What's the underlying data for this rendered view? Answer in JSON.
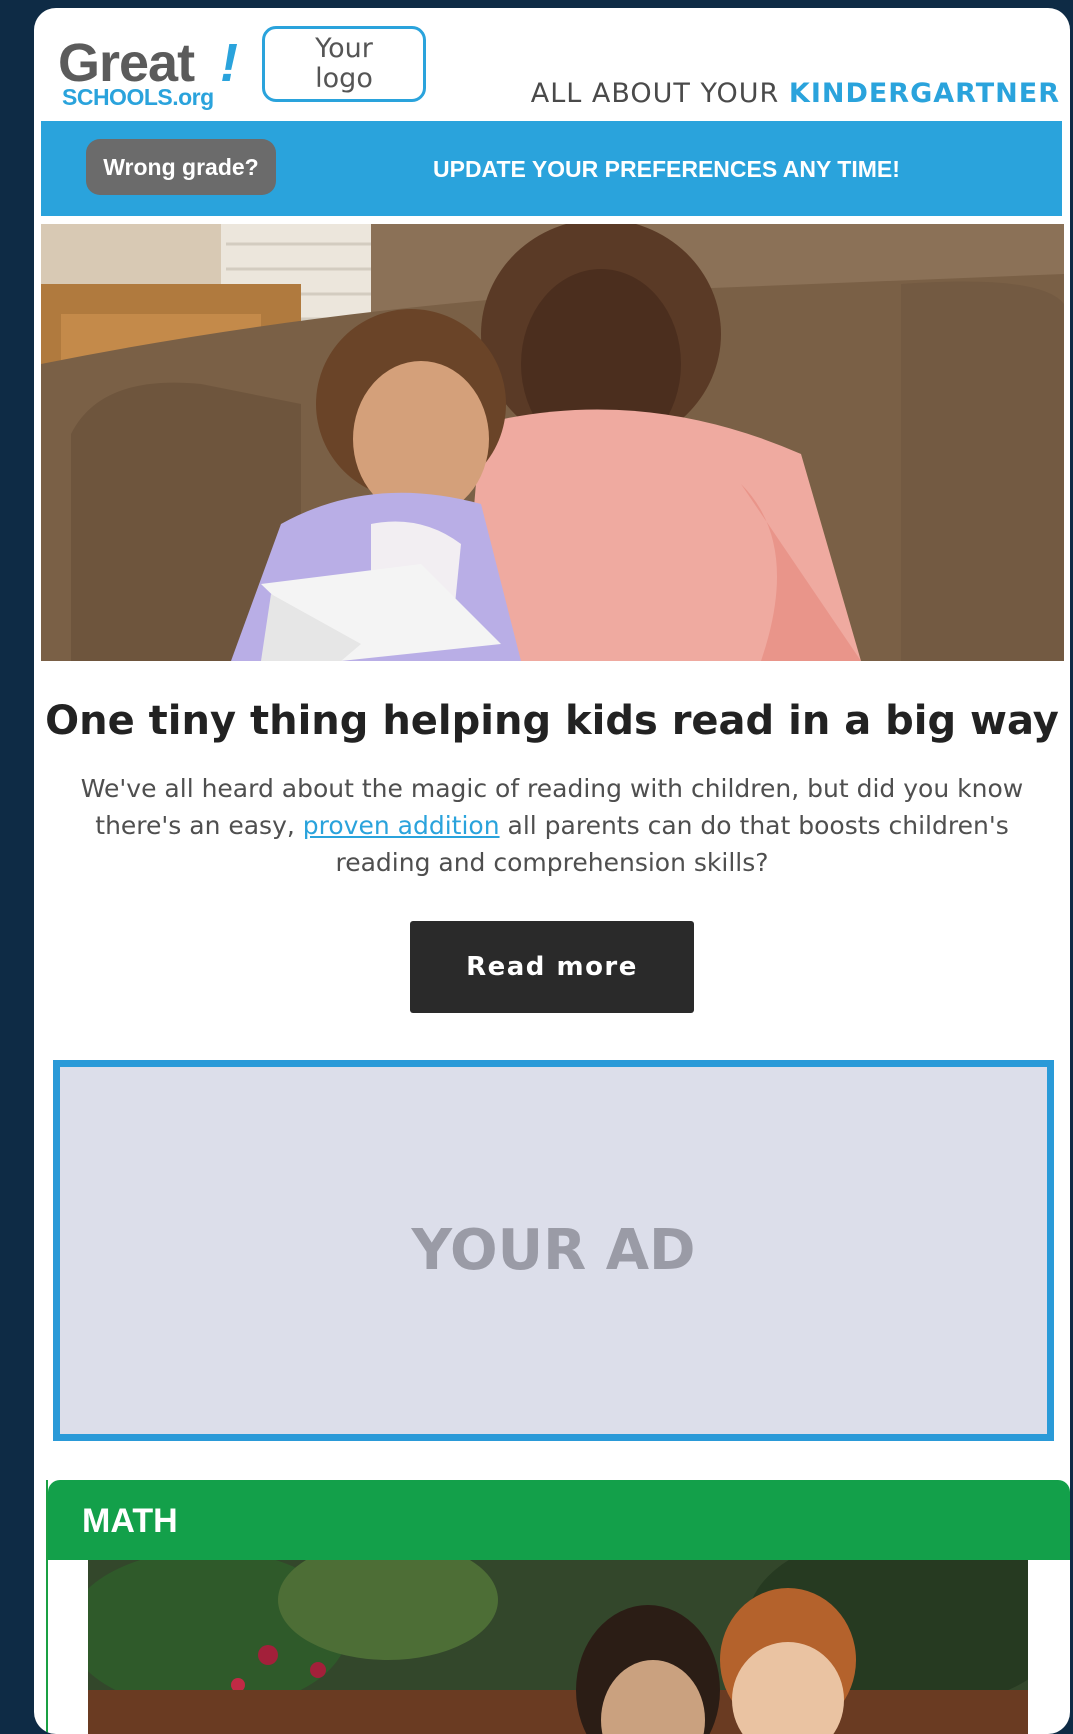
{
  "header": {
    "brand_main": "Great",
    "brand_excl": "!",
    "brand_sub": "SCHOOLS.org",
    "your_logo_line1": "Your",
    "your_logo_line2": "logo",
    "tagline_prefix": "ALL ABOUT YOUR ",
    "tagline_keyword": "KINDERGARTNER"
  },
  "banner": {
    "wrong_grade_label": "Wrong grade?",
    "update_text": "UPDATE YOUR PREFERENCES ANY TIME!"
  },
  "article": {
    "headline": "One tiny thing helping kids read in a big way",
    "body_before": "We've all heard about the magic of reading with children, but did you know there's an easy, ",
    "link_text": "proven addition",
    "body_after": " all parents can do that boosts children's reading and comprehension skills?",
    "cta_label": "Read more"
  },
  "ad": {
    "label": "YOUR AD"
  },
  "math": {
    "section_label": "MATH"
  },
  "colors": {
    "brand_blue": "#2aa3dc",
    "math_green": "#13a04a",
    "button_dark": "#2a2a2a",
    "page_background": "#0e2b45"
  }
}
